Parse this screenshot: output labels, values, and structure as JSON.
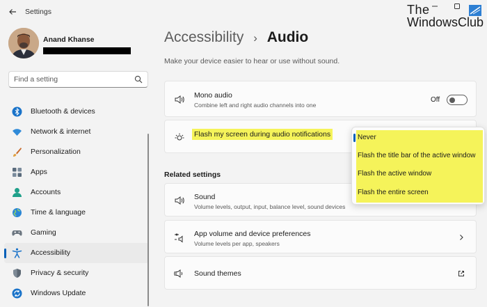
{
  "app": {
    "title": "Settings"
  },
  "watermark": {
    "line1": "The",
    "line2": "WindowsClub"
  },
  "user": {
    "name": "Anand Khanse"
  },
  "search": {
    "placeholder": "Find a setting"
  },
  "nav": {
    "items": [
      {
        "label": "Bluetooth & devices",
        "icon": "bluetooth-icon",
        "active": false
      },
      {
        "label": "Network & internet",
        "icon": "wifi-icon",
        "active": false
      },
      {
        "label": "Personalization",
        "icon": "brush-icon",
        "active": false
      },
      {
        "label": "Apps",
        "icon": "apps-icon",
        "active": false
      },
      {
        "label": "Accounts",
        "icon": "person-icon",
        "active": false
      },
      {
        "label": "Time & language",
        "icon": "globe-icon",
        "active": false
      },
      {
        "label": "Gaming",
        "icon": "gamepad-icon",
        "active": false
      },
      {
        "label": "Accessibility",
        "icon": "accessibility-icon",
        "active": true
      },
      {
        "label": "Privacy & security",
        "icon": "shield-icon",
        "active": false
      },
      {
        "label": "Windows Update",
        "icon": "update-icon",
        "active": false
      }
    ]
  },
  "page": {
    "parent": "Accessibility",
    "separator": "›",
    "current": "Audio",
    "description": "Make your device easier to hear or use without sound."
  },
  "mono": {
    "title": "Mono audio",
    "subtitle": "Combine left and right audio channels into one",
    "toggle_label": "Off",
    "toggle_on": false
  },
  "flash": {
    "title": "Flash my screen during audio notifications",
    "options": [
      "Never",
      "Flash the title bar of the active window",
      "Flash the active window",
      "Flash the entire screen"
    ],
    "selected": "Never"
  },
  "related": {
    "label": "Related settings",
    "sound": {
      "title": "Sound",
      "subtitle": "Volume levels, output, input, balance level, sound devices"
    },
    "app_volume": {
      "title": "App volume and device preferences",
      "subtitle": "Volume levels per app, speakers"
    },
    "sound_themes": {
      "title": "Sound themes"
    }
  },
  "colors": {
    "accent": "#005fb8",
    "highlight": "#f5f35a"
  }
}
